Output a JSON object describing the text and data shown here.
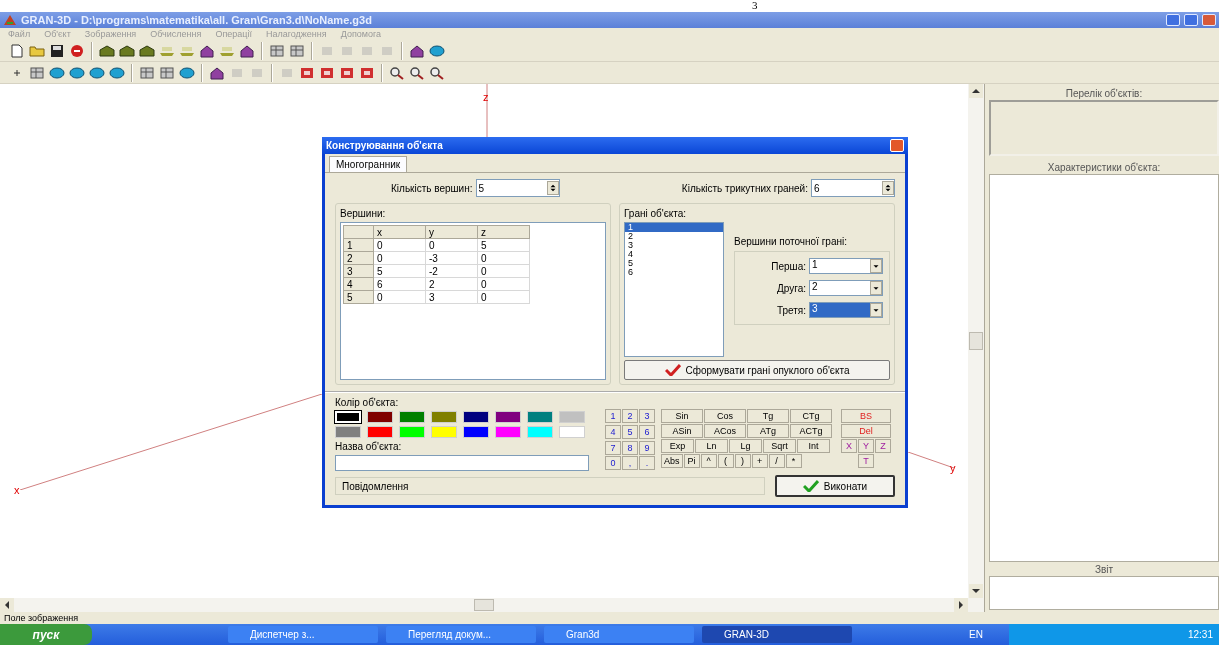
{
  "page_mark": "3",
  "window": {
    "title": "GRAN-3D - D:\\programs\\matematika\\all. Gran\\Gran3.d\\NoName.g3d"
  },
  "menu": [
    "Файл",
    "Об'єкт",
    "Зображення",
    "Обчислення",
    "Операції",
    "Налагодження",
    "Допомога"
  ],
  "toolbars": [
    [
      {
        "kind": "doc"
      },
      {
        "kind": "folder"
      },
      {
        "kind": "disk"
      },
      {
        "kind": "stop"
      },
      {
        "kind": "sep"
      },
      {
        "kind": "solid"
      },
      {
        "kind": "solid"
      },
      {
        "kind": "solid"
      },
      {
        "kind": "plane"
      },
      {
        "kind": "plane"
      },
      {
        "kind": "roof"
      },
      {
        "kind": "plane"
      },
      {
        "kind": "roof"
      },
      {
        "kind": "sep"
      },
      {
        "kind": "grid"
      },
      {
        "kind": "grid"
      },
      {
        "kind": "sep"
      },
      {
        "kind": "dim"
      },
      {
        "kind": "dim"
      },
      {
        "kind": "dim"
      },
      {
        "kind": "dim"
      },
      {
        "kind": "sep"
      },
      {
        "kind": "roof"
      },
      {
        "kind": "globe"
      }
    ],
    [
      {
        "kind": "point"
      },
      {
        "kind": "grid"
      },
      {
        "kind": "globe"
      },
      {
        "kind": "globe"
      },
      {
        "kind": "globe"
      },
      {
        "kind": "globe"
      },
      {
        "kind": "sep"
      },
      {
        "kind": "grid"
      },
      {
        "kind": "grid"
      },
      {
        "kind": "globe"
      },
      {
        "kind": "sep"
      },
      {
        "kind": "roof"
      },
      {
        "kind": "dim"
      },
      {
        "kind": "dim"
      },
      {
        "kind": "sep"
      },
      {
        "kind": "dim"
      },
      {
        "kind": "red"
      },
      {
        "kind": "red"
      },
      {
        "kind": "red"
      },
      {
        "kind": "red"
      },
      {
        "kind": "sep"
      },
      {
        "kind": "zoom"
      },
      {
        "kind": "zoom"
      },
      {
        "kind": "zoom"
      }
    ]
  ],
  "canvas": {
    "axes": [
      {
        "label": "z"
      },
      {
        "label": "x"
      },
      {
        "label": "y"
      }
    ]
  },
  "dialog": {
    "title": "Конструювання об'єкта",
    "tabs": [
      {
        "label": "Многогранник",
        "selected": true
      }
    ],
    "vertex_count": {
      "label": "Кількість вершин:",
      "value": "5"
    },
    "face_count": {
      "label": "Кількість трикутних граней:",
      "value": "6"
    },
    "vertices": {
      "title": "Вершини:",
      "columns": [
        "x",
        "y",
        "z"
      ],
      "rows": [
        {
          "index": "1",
          "cells": [
            "0",
            "0",
            "5"
          ]
        },
        {
          "index": "2",
          "cells": [
            "0",
            "-3",
            "0"
          ]
        },
        {
          "index": "3",
          "cells": [
            "5",
            "-2",
            "0"
          ]
        },
        {
          "index": "4",
          "cells": [
            "6",
            "2",
            "0"
          ]
        },
        {
          "index": "5",
          "cells": [
            "0",
            "3",
            "0"
          ]
        }
      ]
    },
    "faces": {
      "title": "Грані об'єкта:",
      "items": [
        {
          "label": "1",
          "selected": true
        },
        {
          "label": "2",
          "selected": false
        },
        {
          "label": "3",
          "selected": false
        },
        {
          "label": "4",
          "selected": false
        },
        {
          "label": "5",
          "selected": false
        },
        {
          "label": "6",
          "selected": false
        }
      ]
    },
    "face_vertices": {
      "title": "Вершини поточної грані:",
      "fields": [
        {
          "label": "Перша:",
          "value": "1",
          "selected": false
        },
        {
          "label": "Друга:",
          "value": "2",
          "selected": false
        },
        {
          "label": "Третя:",
          "value": "3",
          "selected": true
        }
      ]
    },
    "build_button": "Сформувати грані опуклого об'єкта",
    "color_title": "Колір об'єкта:",
    "colors": [
      {
        "color": "#000000",
        "selected": true
      },
      {
        "color": "#800000",
        "selected": false
      },
      {
        "color": "#008000",
        "selected": false
      },
      {
        "color": "#808000",
        "selected": false
      },
      {
        "color": "#000080",
        "selected": false
      },
      {
        "color": "#800080",
        "selected": false
      },
      {
        "color": "#008080",
        "selected": false
      },
      {
        "color": "#c0c0c0",
        "selected": false
      },
      {
        "color": "#808080",
        "selected": false
      },
      {
        "color": "#ff0000",
        "selected": false
      },
      {
        "color": "#00ff00",
        "selected": false
      },
      {
        "color": "#ffff00",
        "selected": false
      },
      {
        "color": "#0000ff",
        "selected": false
      },
      {
        "color": "#ff00ff",
        "selected": false
      },
      {
        "color": "#00ffff",
        "selected": false
      },
      {
        "color": "#ffffff",
        "selected": false
      }
    ],
    "name_label": "Назва об'єкта:",
    "keypad": {
      "digits": [
        "1",
        "2",
        "3",
        "4",
        "5",
        "6",
        "7",
        "8",
        "9",
        "0",
        ",",
        "."
      ],
      "functions": [
        [
          "Sin",
          "Cos",
          "Tg",
          "CTg"
        ],
        [
          "ASin",
          "ACos",
          "ATg",
          "ACTg"
        ],
        [
          "Exp",
          "Ln",
          "Lg",
          "Sqrt",
          "Int"
        ],
        [
          "Abs",
          "Pi",
          "^",
          "(",
          ")",
          "+",
          "/",
          "*"
        ]
      ],
      "edit": [
        "BS",
        "Del"
      ],
      "variables": [
        "X",
        "Y",
        "Z",
        "T"
      ]
    },
    "message": "Повідомлення",
    "run_button": "Виконати"
  },
  "side_panel": {
    "objects_title": "Перелік об'єктів:",
    "properties_title": "Характеристики об'єкта:",
    "report_title": "Звіт"
  },
  "status_bar": "Поле зображення",
  "taskbar": {
    "start": "пуск",
    "tasks": [
      {
        "label": "Диспетчер з...",
        "selected": false
      },
      {
        "label": "Перегляд докум...",
        "selected": false
      },
      {
        "label": "Gran3d",
        "selected": false
      },
      {
        "label": "GRAN-3D",
        "selected": true
      }
    ],
    "language": "EN",
    "time": "12:31"
  }
}
